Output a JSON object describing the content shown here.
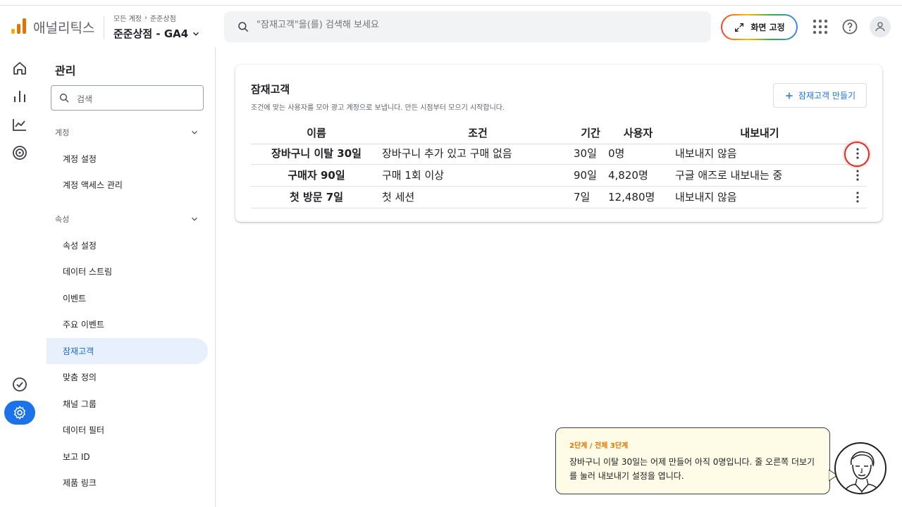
{
  "header": {
    "app_name": "애널리틱스",
    "breadcrumb": [
      "모든 계정",
      "준준상점"
    ],
    "property": "준준상점 - GA4",
    "search_placeholder": "\"잠재고객\"을(를) 검색해 보세요",
    "fix_screen_label": "화면 고정",
    "logo_colors": [
      "#f9ab00",
      "#e37400",
      "#e37400"
    ]
  },
  "rail": {
    "icons": [
      "home-icon",
      "reports-icon",
      "explore-icon",
      "advertising-icon",
      "check-circle-icon",
      "admin-gear-icon"
    ]
  },
  "sidebar": {
    "title": "관리",
    "search_placeholder": "검색",
    "account_section": "계정",
    "account_items": [
      "계정 설정",
      "계정 액세스 관리"
    ],
    "property_section": "속성",
    "property_items": [
      "속성 설정",
      "데이터 스트림",
      "이벤트",
      "주요 이벤트",
      "잠재고객",
      "맞춤 정의",
      "채널 그룹",
      "데이터 필터",
      "보고 ID",
      "제품 링크"
    ],
    "active_item": "잠재고객"
  },
  "card": {
    "title": "잠재고객",
    "subtitle": "조건에 맞는 사용자를 모아 광고 계정으로 보냅니다. 만든 시점부터 모으기 시작합니다.",
    "create_button": "잠재고객 만들기",
    "columns": [
      "이름",
      "조건",
      "기간",
      "사용자",
      "내보내기"
    ],
    "rows": [
      {
        "name": "장바구니 이탈 30일",
        "condition": "장바구니 추가 있고 구매 없음",
        "period": "30일",
        "users": "0명",
        "export": "내보내지 않음"
      },
      {
        "name": "구매자 90일",
        "condition": "구매 1회 이상",
        "period": "90일",
        "users": "4,820명",
        "export": "구글 애즈로 내보내는 중"
      },
      {
        "name": "첫 방문 7일",
        "condition": "첫 세션",
        "period": "7일",
        "users": "12,480명",
        "export": "내보내지 않음"
      }
    ]
  },
  "tour": {
    "step": "2단계 / 전체 3단계",
    "text": "장바구니 이탈 30일는 어제 만들어 아직 0명입니다. 줄 오른쪽 더보기를 눌러 내보내기 설정을 엽니다."
  },
  "colors": {
    "accent": "#1a73e8",
    "highlight": "#d93025",
    "bubble_bg": "#fefbe6",
    "step_color": "#e37400"
  }
}
